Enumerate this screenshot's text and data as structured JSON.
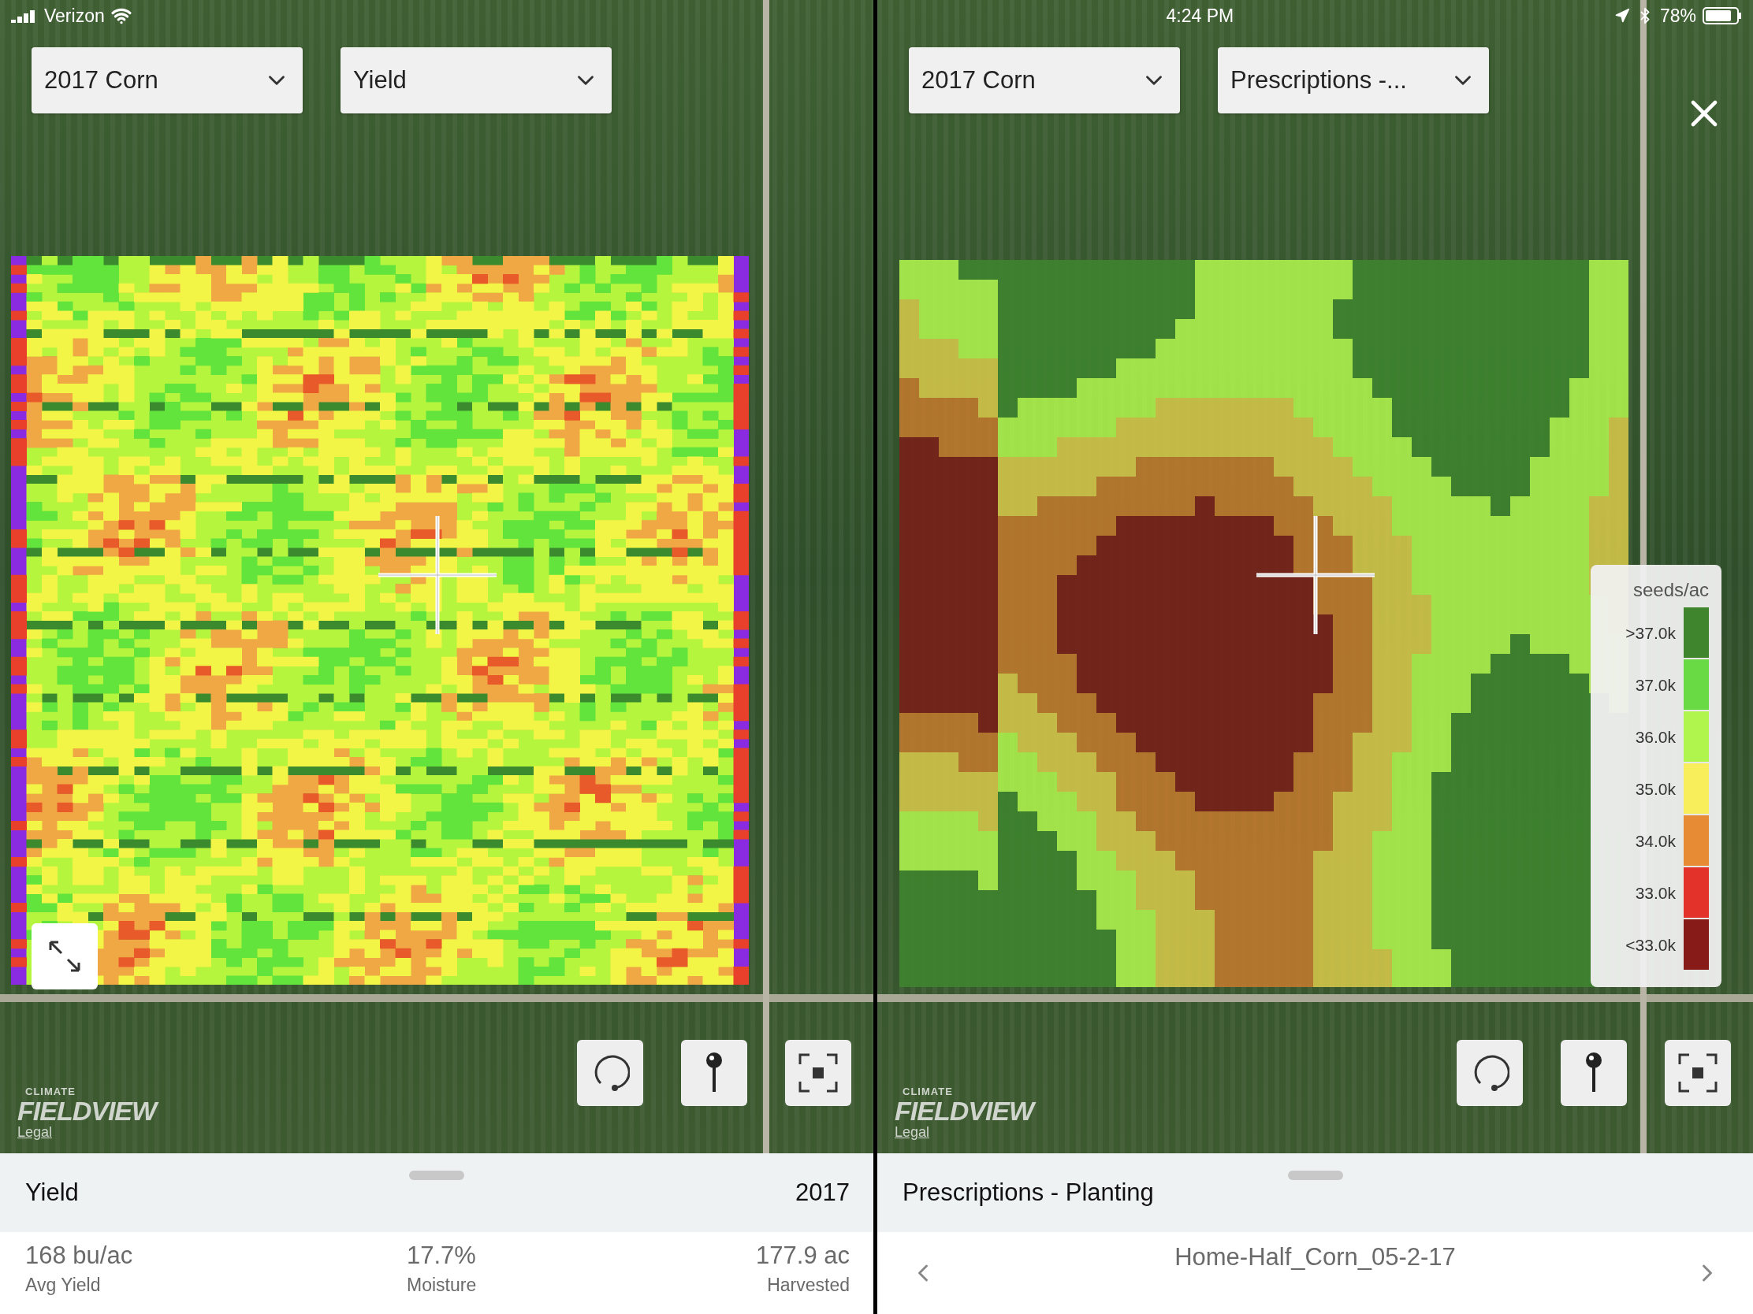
{
  "status_bar": {
    "carrier": "Verizon",
    "time": "4:24 PM",
    "battery": "78%"
  },
  "left_pane": {
    "dropdowns": [
      {
        "label": "2017 Corn"
      },
      {
        "label": "Yield"
      }
    ],
    "logo": {
      "small": "CLIMATE",
      "brand": "FIELDVIEW",
      "legal": "Legal"
    },
    "header": {
      "title": "Yield",
      "year": "2017"
    },
    "stats": [
      {
        "value": "168 bu/ac",
        "label": "Avg Yield"
      },
      {
        "value": "17.7%",
        "label": "Moisture"
      },
      {
        "value": "177.9 ac",
        "label": "Harvested"
      }
    ]
  },
  "right_pane": {
    "dropdowns": [
      {
        "label": "2017 Corn"
      },
      {
        "label": "Prescriptions -..."
      }
    ],
    "legend": {
      "title": "seeds/ac",
      "items": [
        {
          "label": ">37.0k",
          "color": "#3e852e"
        },
        {
          "label": "37.0k",
          "color": "#6ada44"
        },
        {
          "label": "36.0k",
          "color": "#b0f54e"
        },
        {
          "label": "35.0k",
          "color": "#f8ed5a"
        },
        {
          "label": "34.0k",
          "color": "#e88b35"
        },
        {
          "label": "33.0k",
          "color": "#e3322a"
        },
        {
          "label": "<33.0k",
          "color": "#861b17"
        }
      ]
    },
    "logo": {
      "small": "CLIMATE",
      "brand": "FIELDVIEW",
      "legal": "Legal"
    },
    "header": {
      "title": "Prescriptions - Planting"
    },
    "file_name": "Home-Half_Corn_05-2-17"
  }
}
